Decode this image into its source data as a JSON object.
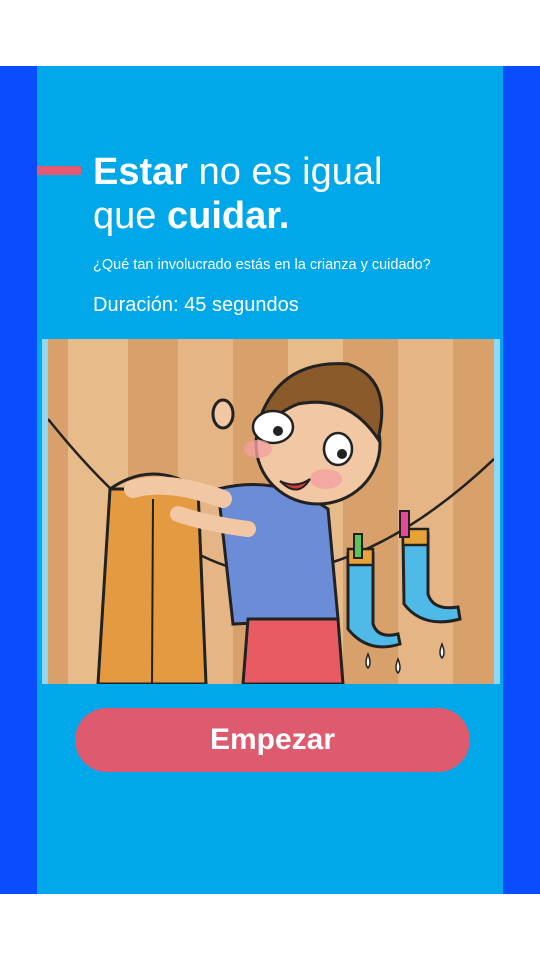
{
  "header": {
    "title_line1_bold": "Estar",
    "title_line1_rest": " no es igual",
    "title_line2_start": "que ",
    "title_line2_bold": "cuidar."
  },
  "subtitle": "¿Qué tan involucrado estás en la crianza y cuidado?",
  "duration": "Duración: 45 segundos",
  "start_button": {
    "label": "Empezar"
  },
  "colors": {
    "frame": "#0a4cff",
    "panel": "#00a8ea",
    "accent": "#e55a72",
    "button": "#de5a6e"
  }
}
